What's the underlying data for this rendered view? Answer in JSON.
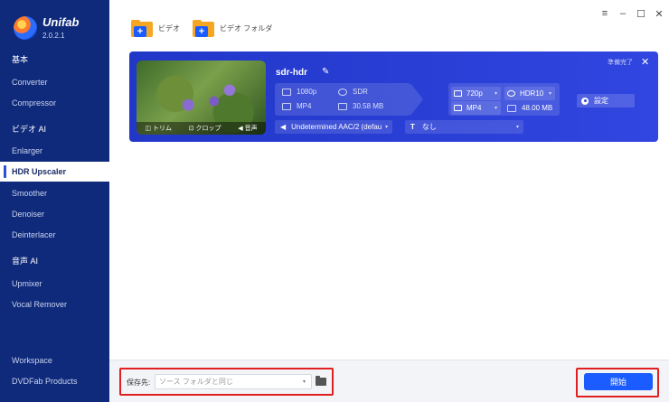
{
  "app": {
    "name": "Unifab",
    "version": "2.0.2.1"
  },
  "sidebar": {
    "groups": [
      {
        "label": "基本",
        "items": [
          "Converter",
          "Compressor"
        ]
      },
      {
        "label": "ビデオ AI",
        "items": [
          "Enlarger",
          "HDR Upscaler",
          "Smoother",
          "Denoiser",
          "Deinterlacer"
        ]
      },
      {
        "label": "音声 AI",
        "items": [
          "Upmixer",
          "Vocal Remover"
        ]
      }
    ],
    "active_item": "HDR Upscaler",
    "footer": [
      "Workspace",
      "DVDFab Products"
    ]
  },
  "window_controls": {
    "menu": "≡",
    "minimize": "–",
    "maximize": "☐",
    "close": "✕"
  },
  "toolbar": {
    "add_video": "ビデオ",
    "add_folder": "ビデオ フォルダ"
  },
  "task": {
    "file_name": "sdr-hdr",
    "status": "準備完了",
    "thumb_tools": {
      "trim": "トリム",
      "crop": "クロップ",
      "audio": "音声"
    },
    "source": {
      "resolution": "1080p",
      "dynamic_range": "SDR",
      "format": "MP4",
      "size": "30.58 MB"
    },
    "output": {
      "resolution": "720p",
      "dynamic_range": "HDR10",
      "format": "MP4",
      "size": "48.00 MB"
    },
    "settings_label": "設定",
    "audio_track": "Undetermined AAC/2 (defau",
    "subtitle": "なし"
  },
  "bottom": {
    "save_label": "保存先:",
    "save_placeholder": "ソース フォルダと同じ",
    "start_label": "開始"
  },
  "colors": {
    "sidebar_bg": "#0f2a7a",
    "card_bg": "#2a3fd6",
    "accent": "#1a5cff",
    "highlight_frame": "#e02020"
  }
}
